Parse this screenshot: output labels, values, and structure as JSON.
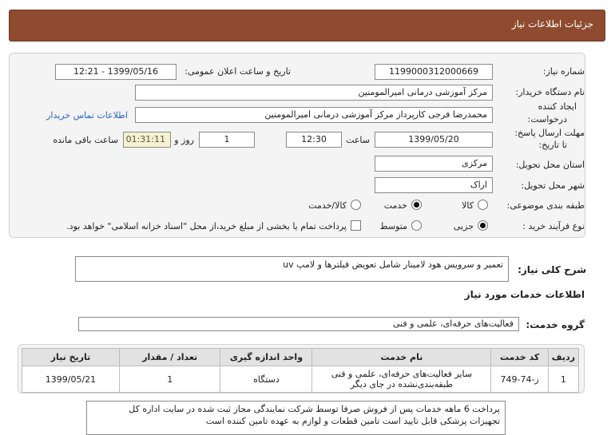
{
  "page_title": "جزئیات اطلاعات نیاز",
  "need_number": {
    "label": "شماره نیاز:",
    "value": "1199000312000669"
  },
  "announce_date": {
    "label": "تاریخ و ساعت اعلان عمومی:",
    "value": "1399/05/16 - 12:21"
  },
  "buyer_org": {
    "label": "نام دستگاه خریدار:",
    "value": "مرکز آموزشی درمانی امیرالمومنین"
  },
  "requester": {
    "label_line1": "ایجاد کننده",
    "label_line2": "درخواست:",
    "value": "محمدرضا فرجی کارپرداز مرکز آموزشی درمانی امیرالمومنین",
    "contact_link": "اطلاعات تماس خریدار"
  },
  "deadline": {
    "label_line1": "مهلت ارسال پاسخ:",
    "label_line2": "تا تاریخ:",
    "date": "1399/05/20",
    "time_label": "ساعت",
    "time": "12:30",
    "days": "1",
    "days_label": "روز و",
    "remaining": "01:31:11",
    "remaining_label": "ساعت باقی مانده"
  },
  "province": {
    "label": "استان محل تحویل:",
    "value": "مرکزی"
  },
  "city": {
    "label": "شهر محل تحویل:",
    "value": "اراک"
  },
  "category": {
    "label": "طبقه بندی موضوعی:",
    "options": [
      "کالا",
      "خدمت",
      "کالا/خدمت"
    ],
    "selected": "خدمت"
  },
  "process": {
    "label": "نوع فرآیند خرید :",
    "options": [
      "جزیی",
      "متوسط"
    ],
    "selected": "جزیی",
    "payment_note": "پرداخت تمام یا بخشی از مبلغ خرید،از محل \"اسناد خزانه اسلامی\" خواهد بود."
  },
  "summary": {
    "label": "شرح کلی نیاز:",
    "value": "تعمیر و سرویس هود لامینار شامل تعویض فیلترها و لامپ uv"
  },
  "services_section": "اطلاعات خدمات مورد نیاز",
  "service_group": {
    "label": "گروه خدمت:",
    "value": "فعالیت‌های حرفه‌ای، علمی و فنی"
  },
  "table": {
    "headers": [
      "ردیف",
      "کد خدمت",
      "نام خدمت",
      "واحد اندازه گیری",
      "تعداد / مقدار",
      "تاریخ نیاز"
    ],
    "rows": [
      [
        "1",
        "ز-74-749",
        "سایر فعالیت‌های حرفه‌ای، علمی و فنی طبقه‌بندی‌نشده در جای دیگر",
        "دستگاه",
        "1",
        "1399/05/21"
      ]
    ]
  },
  "buyer_notes": {
    "line1": "پرداخت 6 ماهه خدمات پس از فروش صرفا توسط شرکت نمایندگی مجاز ثبت شده در سایت اداره کل",
    "line2": "تجهیزات پزشکی قابل تایید است تامین قطعات و لوازم به عهده تامین کننده است"
  }
}
